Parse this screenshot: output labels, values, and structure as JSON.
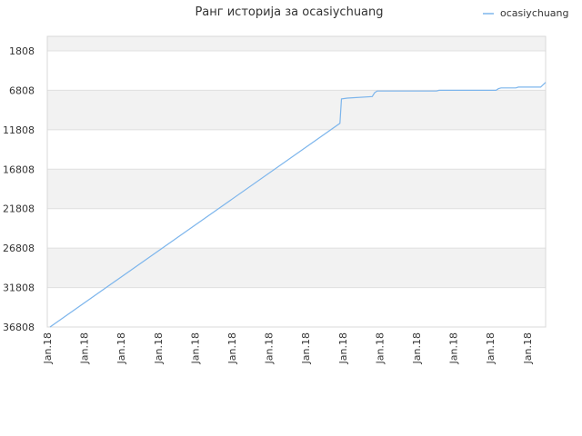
{
  "chart_data": {
    "type": "line",
    "title": "Ранг историја за ocasiychuang",
    "xlabel": "",
    "ylabel": "",
    "y_axis_inverted": true,
    "ylim": [
      36808,
      1808
    ],
    "y_ticks": [
      "1808",
      "6808",
      "11808",
      "16808",
      "21808",
      "26808",
      "31808",
      "36808"
    ],
    "x_ticks": [
      "Jan.18",
      "Jan.18",
      "Jan.18",
      "Jan.18",
      "Jan.18",
      "Jan.18",
      "Jan.18",
      "Jan.18",
      "Jan.18",
      "Jan.18",
      "Jan.18",
      "Jan.18",
      "Jan.18",
      "Jan.18"
    ],
    "grid": true,
    "legend": "top-right",
    "colors": {
      "series": "#7cb5ec",
      "band": "#f2f2f2",
      "grid": "#e0e0e0"
    },
    "series": [
      {
        "name": "ocasiychuang",
        "x": [
          0,
          0.585,
          0.588,
          0.6,
          0.65,
          0.655,
          0.66,
          0.78,
          0.785,
          0.9,
          0.905,
          0.91,
          0.94,
          0.945,
          0.99,
          1.0
        ],
        "values": [
          36808,
          11000,
          7900,
          7800,
          7600,
          7100,
          6900,
          6900,
          6800,
          6800,
          6600,
          6500,
          6500,
          6400,
          6400,
          5800
        ]
      }
    ]
  }
}
